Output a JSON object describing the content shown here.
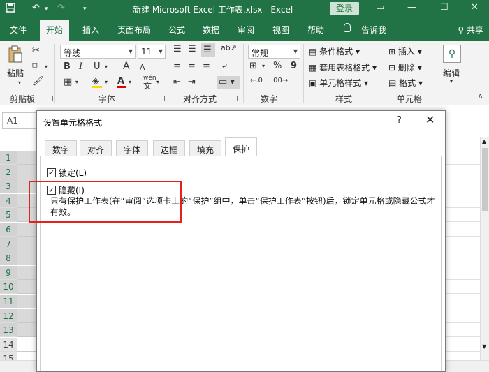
{
  "titlebar": {
    "title": "新建 Microsoft Excel 工作表.xlsx  -  Excel",
    "login": "登录"
  },
  "tabs": [
    "文件",
    "开始",
    "插入",
    "页面布局",
    "公式",
    "数据",
    "审阅",
    "视图",
    "帮助"
  ],
  "active_tab": "开始",
  "tell_me": "告诉我",
  "share": "共享",
  "ribbon": {
    "clipboard": {
      "paste": "粘贴",
      "label": "剪贴板"
    },
    "font": {
      "name": "等线",
      "size": "11",
      "label": "字体",
      "bold": "B",
      "italic": "I",
      "underline": "U",
      "grow": "A",
      "shrink": "A",
      "wen": "wén",
      "font_color": "A"
    },
    "alignment": {
      "label": "对齐方式"
    },
    "number": {
      "format": "常规",
      "percent": "%",
      "comma": "9",
      "label": "数字"
    },
    "styles": {
      "conditional": "条件格式",
      "table": "套用表格格式",
      "cell_styles": "单元格样式",
      "label": "样式"
    },
    "cells": {
      "insert": "插入",
      "delete": "删除",
      "format": "格式",
      "label": "单元格"
    },
    "editing": {
      "label": "编辑"
    }
  },
  "namebox": "A1",
  "rows": [
    "1",
    "2",
    "3",
    "4",
    "5",
    "6",
    "7",
    "8",
    "9",
    "10",
    "11",
    "12",
    "13",
    "14",
    "15"
  ],
  "dialog": {
    "title": "设置单元格格式",
    "help": "?",
    "close": "✕",
    "tabs": [
      "数字",
      "对齐",
      "字体",
      "边框",
      "填充",
      "保护"
    ],
    "active_tab": "保护",
    "lock_label": "锁定(L)",
    "lock_checked": true,
    "hide_label": "隐藏(I)",
    "hide_checked": true,
    "description": "只有保护工作表(在“审阅”选项卡上的“保护”组中，单击“保护工作表”按钮)后，锁定单元格或隐藏公式才有效。"
  },
  "colors": {
    "excel_green": "#217346",
    "highlight": "#e4211c"
  }
}
